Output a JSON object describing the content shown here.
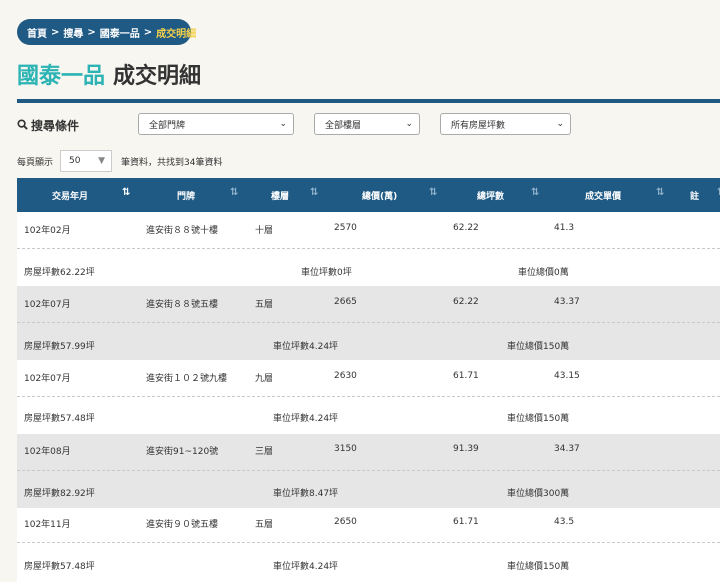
{
  "breadcrumb": {
    "items": [
      "首頁",
      "搜尋",
      "國泰一品"
    ],
    "current": "成交明細",
    "separator": ">"
  },
  "title": {
    "project": "國泰一品",
    "section": "成交明細"
  },
  "search": {
    "label": "搜尋條件",
    "filters": [
      {
        "selected": "全部門牌"
      },
      {
        "selected": "全部樓層"
      },
      {
        "selected": "所有房屋坪數"
      }
    ]
  },
  "paging": {
    "per_page_label": "每頁顯示",
    "per_page_value": "50",
    "result_text": "筆資料，共找到34筆資料"
  },
  "table": {
    "headers": [
      "交易年月",
      "門牌",
      "樓層",
      "總價(萬)",
      "總坪數",
      "成交單價",
      "註"
    ],
    "rows": [
      {
        "date": "102年02月",
        "address": "進安街８８號十樓",
        "floor": "十層",
        "total": "2570",
        "area": "62.22",
        "unit_price": "41.3",
        "detail_house": "房屋坪數62.22坪",
        "detail_parking_area": "車位坪數0坪",
        "detail_parking_price": "車位總價0萬"
      },
      {
        "date": "102年07月",
        "address": "進安街８８號五樓",
        "floor": "五層",
        "total": "2665",
        "area": "62.22",
        "unit_price": "43.37",
        "detail_house": "房屋坪數57.99坪",
        "detail_parking_area": "車位坪數4.24坪",
        "detail_parking_price": "車位總價150萬"
      },
      {
        "date": "102年07月",
        "address": "進安街１０２號九樓",
        "floor": "九層",
        "total": "2630",
        "area": "61.71",
        "unit_price": "43.15",
        "detail_house": "房屋坪數57.48坪",
        "detail_parking_area": "車位坪數4.24坪",
        "detail_parking_price": "車位總價150萬"
      },
      {
        "date": "102年08月",
        "address": "進安街91~120號",
        "floor": "三層",
        "total": "3150",
        "area": "91.39",
        "unit_price": "34.37",
        "detail_house": "房屋坪數82.92坪",
        "detail_parking_area": "車位坪數8.47坪",
        "detail_parking_price": "車位總價300萬"
      },
      {
        "date": "102年11月",
        "address": "進安街９０號五樓",
        "floor": "五層",
        "total": "2650",
        "area": "61.71",
        "unit_price": "43.5",
        "detail_house": "房屋坪數57.48坪",
        "detail_parking_area": "車位坪數4.24坪",
        "detail_parking_price": "車位總價150萬"
      }
    ]
  },
  "colors": {
    "primary": "#1f5a85",
    "accent_title": "#2cb3b3",
    "breadcrumb_current": "#f5d04a",
    "alt_row": "#e6e6e6"
  }
}
